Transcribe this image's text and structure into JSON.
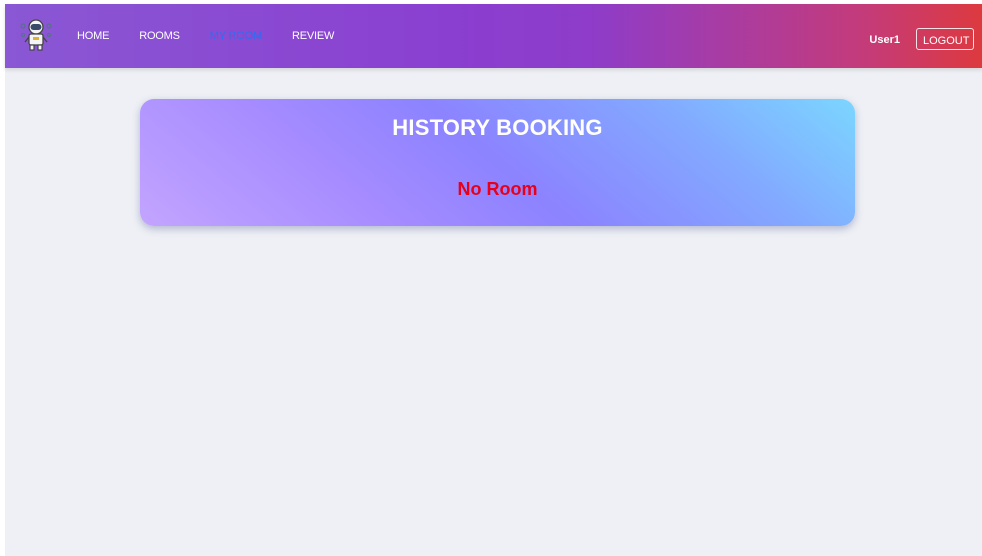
{
  "navbar": {
    "logo_icon": "astronaut-logo-icon",
    "links": [
      {
        "label": "HOME",
        "active": false
      },
      {
        "label": "ROOMS",
        "active": false
      },
      {
        "label": "MY ROOM",
        "active": true
      },
      {
        "label": "REVIEW",
        "active": false
      }
    ],
    "user_name": "User1",
    "logout_label": "LOGOUT",
    "active_link_color": "#2f6cf0"
  },
  "history": {
    "title": "HISTORY BOOKING",
    "empty_message": "No Room",
    "empty_message_color": "#e8001a"
  }
}
